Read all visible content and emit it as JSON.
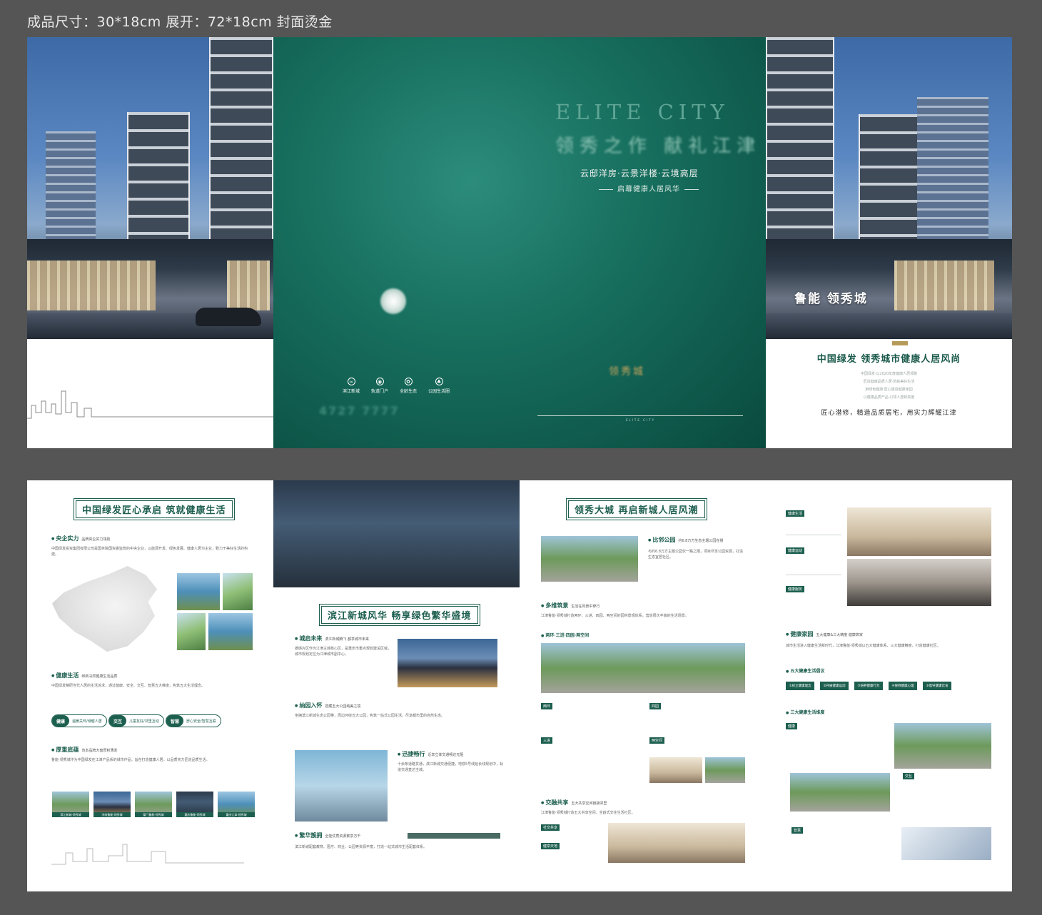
{
  "caption": "成品尺寸：30*18cm 展开：72*18cm 封面烫金",
  "cover": {
    "title_en": "ELITE CITY",
    "slogan": "领秀之作 献礼江津",
    "types": "云邸洋房·云景洋楼·云境高层",
    "tagline": "启幕健康人居风华",
    "features": [
      "滨江新城",
      "轨道门户",
      "全龄生态",
      "公园生活圈"
    ],
    "phone": "4727 7777",
    "brand_small": "领秀城",
    "mini_text": "ELITE CITY"
  },
  "right_cover": {
    "brand_tag": "鲁能 领秀城",
    "heading": "中国绿发 领秀城市健康人居风尚",
    "lines": [
      "中国绿发·以2020年度健康人居领跑",
      "匠造健康品质人居·筑就美好生活",
      "用绿色健康·匠心建造健康家园",
      "以健康品质产品·引领人居新高度"
    ],
    "caption": "匠心潜修，精造品质居宅，用实力辉耀江津"
  },
  "page1": {
    "title": "中国绿发匠心承启 筑就健康生活",
    "sec1": {
      "title": "央企实力",
      "sub": "品牌央企实力领航",
      "text": "中国绿发投资集团有限公司是国务院国资委监管的中央企业，以能源开发、绿色发展、健康人居为主业，致力于美好生活的构建。"
    },
    "sec2": {
      "title": "健康生活",
      "sub": "缔新决然健康生活品质",
      "text": "中国绿发精研当代人居的生活诉求，通过健康、安全、交互、智慧五大维度，构筑五大生活理念。"
    },
    "pills": [
      {
        "k": "健康",
        "v": "温暖关怀/绿健人居"
      },
      {
        "k": "交互",
        "v": "儿童友好/邻里互动"
      },
      {
        "k": "智慧",
        "v": "舒心安全/智慧互联"
      }
    ],
    "sec3": {
      "title": "厚重底蕴",
      "sub": "范本品牌大盘厚积薄发",
      "text": "鲁能·领秀城作为中国绿发在江津产品系的城市作品，旨在打造健康人居，以品质实力匠造品质生活。"
    },
    "thumbs": [
      "滨江新城·领秀城",
      "济南鲁能·领秀城",
      "厦门鲁能·领秀城",
      "重庆鲁能·领秀城",
      "重庆江津·领秀城"
    ]
  },
  "page2": {
    "title": "滨江新城风华 畅享绿色繁华盛境",
    "sec1": {
      "title": "城启未来",
      "sub": "滨江新城腾飞 都享城市未来",
      "text": "德感片区作为江津主城核心区，是重庆市重点规划建设区域，城市规划定位为江津城市副中心。"
    },
    "sec2": {
      "title": "纳园入怀",
      "sub": "揽藏五大公园纯美之境",
      "text": "坐拥滨江新城生态公园带，周边环绕五大公园，构筑一站式公园生活，尽享都市里的自然生态。"
    },
    "sec3": {
      "title": "迅捷畅行",
      "sub": "近享立体交通畅达无阻",
      "text": "十余条道路贯通，滨江新城交通便捷，地铁5号线延长线规划中，轨道交通直达主城。"
    },
    "sec4": {
      "title": "繁华簇拥",
      "sub": "全能优质资源繁享万千",
      "text": "滨江新城配套教育、医疗、商业、公园等资源丰富，打造一站式城市生活配套体系。"
    }
  },
  "page3": {
    "title": "领秀大城 再启新城人居风潮",
    "sec1": {
      "title": "比邻公园",
      "sub": "约6.8万方生态主题公园在侧",
      "text": "与约6.8万方主题公园仅一路之隔，项目尽享公园资源，打造生态宜居社区。"
    },
    "sec2": {
      "title": "多维筑景",
      "sub": "生活在风景中穿行",
      "text": "江津鲁能·领秀城打造两环、三进、四园、两空间的园林景观体系，营造层次丰富的生活场景。"
    },
    "sub2": "两环·三进·四园·两空间",
    "tags": [
      "两环",
      "四园",
      "三进",
      "两空间"
    ],
    "sec3": {
      "title": "交融共享",
      "sub": "五大共享空间链接邻里",
      "text": "江津鲁能·领秀城打造五大共享空间，全龄式交往生活社区。"
    },
    "tags2": [
      "社交共享",
      "健享天地"
    ]
  },
  "page4": {
    "labels": [
      "健康生活",
      "健康运动",
      "健康服务"
    ],
    "sec1": {
      "title": "健康家园",
      "sub": "五大健康&三大精度 健康筑家",
      "text": "城市生活进入健康生活新时代，江津鲁能·领秀城以五大健康体系、三大健康精度，打造健康社区。"
    },
    "sub1": "五大健康生活倡议",
    "btns": [
      "①树立健康理念",
      "②开展健康运动",
      "③培养健康行为",
      "④保持健康心理",
      "⑤倡导健康饮食"
    ],
    "sub2": "三大健康生活维度",
    "tags": [
      "健康",
      "交互",
      "智慧"
    ]
  }
}
